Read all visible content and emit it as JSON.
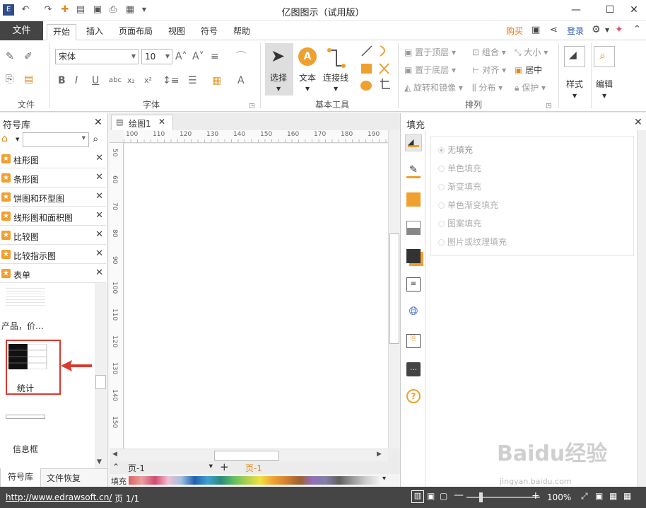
{
  "app": {
    "title": "亿图图示（试用版）",
    "buy": "购买",
    "login": "登录"
  },
  "menu": {
    "file": "文件",
    "tabs": [
      "开始",
      "插入",
      "页面布局",
      "视图",
      "符号",
      "帮助"
    ]
  },
  "ribbon": {
    "groups": {
      "file": "文件",
      "font": "字体",
      "basic_tools": "基本工具",
      "arrange": "排列"
    },
    "font_name": "宋体",
    "font_size": "10",
    "tools": {
      "select": "选择",
      "text": "文本",
      "connector": "连接线"
    },
    "arrange": {
      "top": "置于顶层",
      "bottom": "置于底层",
      "rotate": "旋转和镜像",
      "group": "组合",
      "align": "对齐",
      "distribute": "分布",
      "size": "大小",
      "center": "居中",
      "protect": "保护"
    },
    "style": "样式",
    "edit": "编辑"
  },
  "left_panel": {
    "title": "符号库",
    "libraries": [
      "柱形图",
      "条形图",
      "饼图和环型图",
      "线形图和面积图",
      "比较图",
      "比较指示图",
      "表单"
    ],
    "shapes": [
      {
        "label": "产品，价…"
      },
      {
        "label": "统计"
      },
      {
        "label": "信息框"
      }
    ],
    "bottom_tabs": [
      "符号库",
      "文件恢复"
    ]
  },
  "canvas": {
    "tab": "绘图1",
    "ruler_h": [
      "100",
      "110",
      "120",
      "130",
      "140",
      "150",
      "160",
      "170",
      "180",
      "190"
    ],
    "ruler_v": [
      "50",
      "60",
      "70",
      "80",
      "90",
      "100",
      "110",
      "120",
      "130",
      "140",
      "150"
    ],
    "page_combo": "页-1",
    "page_tab": "页-1",
    "fill_label": "填充"
  },
  "right_panel": {
    "title": "填充",
    "options": [
      "无填充",
      "单色填充",
      "渐变填充",
      "单色渐变填充",
      "图案填充",
      "图片或纹理填充"
    ],
    "selected": "无填充"
  },
  "status": {
    "url": "http://www.edrawsoft.cn/",
    "page": "页 1/1",
    "zoom": "100%"
  },
  "watermark": {
    "brand": "Baidu经验",
    "url": "jingyan.baidu.com"
  },
  "colors": {
    "accent": "#f0a030",
    "highlight_red": "#d93a2f",
    "file_tab": "#444444"
  }
}
